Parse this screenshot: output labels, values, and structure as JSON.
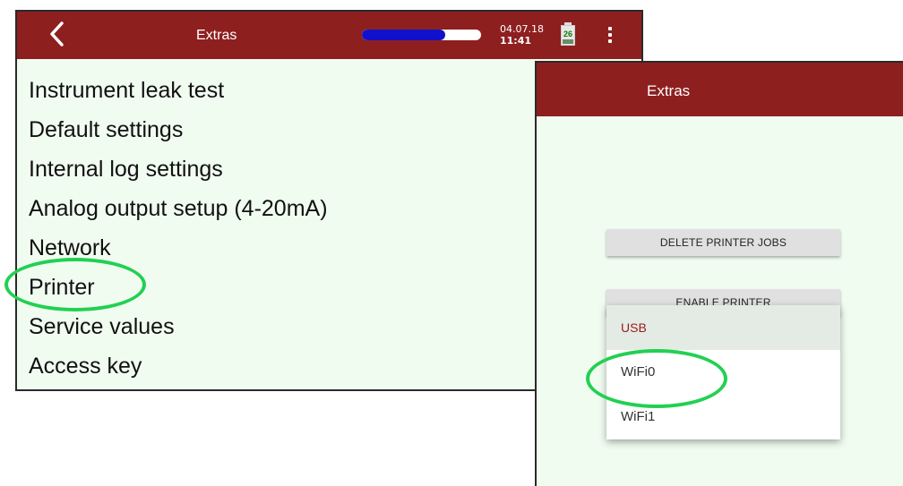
{
  "left_screen": {
    "header": {
      "title": "Extras",
      "progress_percent": 70,
      "date": "04.07.18",
      "time": "11:41",
      "battery_level": "26"
    },
    "menu_items": [
      "Instrument leak test",
      "Default settings",
      "Internal log settings",
      "Analog output setup (4-20mA)",
      "Network",
      "Printer",
      "Service values",
      "Access key"
    ]
  },
  "right_screen": {
    "header": {
      "title": "Extras"
    },
    "buttons": {
      "delete_printer_jobs": "DELETE PRINTER JOBS",
      "enable_printer": "ENABLE PRINTER"
    },
    "dropdown_options": [
      "USB",
      "WiFi0",
      "WiFi1"
    ]
  },
  "colors": {
    "header_bg": "#8e1f1f",
    "screen_bg": "#f1fcf1",
    "highlight_ring": "#22d052",
    "progress_fill": "#1111cc",
    "selected_option_text": "#9a1b1b"
  },
  "icons": {
    "back": "chevron-left-icon",
    "menu": "more-vertical-icon",
    "battery": "battery-icon"
  }
}
